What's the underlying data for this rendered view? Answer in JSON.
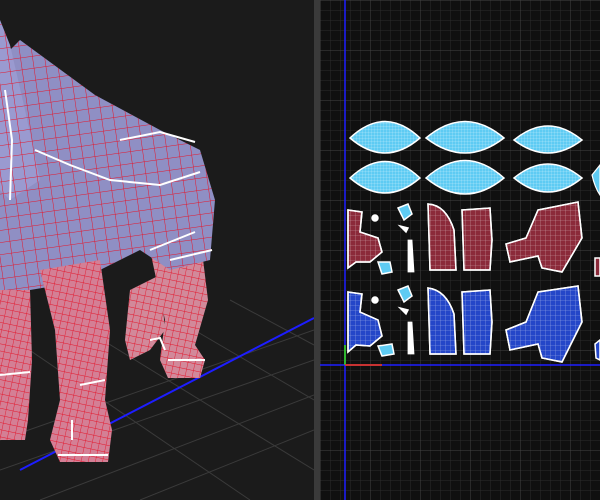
{
  "colors": {
    "viewport_bg": "#1b1b1b",
    "uv_bg": "#101010",
    "splitter": "#3a3a3a",
    "mesh_fill": "#8f8fc4",
    "mesh_wire": "#e3172c",
    "seam": "#ffffff",
    "grid_blue": "#1d1dff",
    "island_cyan": "#5ecbf3",
    "island_red": "#8b2a3a",
    "island_blue": "#2446c8",
    "uv_grid": "#3a3a3a",
    "uv_axis_green": "#2fb52f",
    "uv_axis_red": "#c83232"
  },
  "panels": {
    "viewport": {
      "icon": "mesh-icon"
    },
    "uv": {
      "icon": "uv-grid-icon"
    }
  }
}
